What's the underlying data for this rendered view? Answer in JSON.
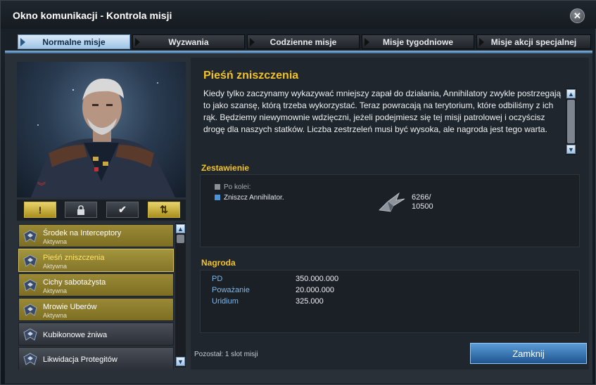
{
  "window": {
    "title": "Okno komunikacji - Kontrola misji",
    "close_icon": "close-icon"
  },
  "tabs": [
    {
      "label": "Normalne misje",
      "active": true
    },
    {
      "label": "Wyzwania",
      "active": false
    },
    {
      "label": "Codzienne misje",
      "active": false
    },
    {
      "label": "Misje tygodniowe",
      "active": false
    },
    {
      "label": "Misje akcji specjalnej",
      "active": false
    }
  ],
  "filters": [
    {
      "icon": "exclamation-icon",
      "glyph": "!"
    },
    {
      "icon": "lock-icon",
      "glyph": "🔒"
    },
    {
      "icon": "checkmark-icon",
      "glyph": "✔"
    },
    {
      "icon": "sort-arrows-icon",
      "glyph": "⇅"
    }
  ],
  "missions": [
    {
      "name": "Środek na Interceptory",
      "status": "Aktywna"
    },
    {
      "name": "Pieśń zniszczenia",
      "status": "Aktywna"
    },
    {
      "name": "Cichy sabotażysta",
      "status": "Aktywna"
    },
    {
      "name": "Mrowie Uberów",
      "status": "Aktywna"
    },
    {
      "name": "Kubikonowe żniwa",
      "status": ""
    },
    {
      "name": "Likwidacja Protegitów",
      "status": ""
    }
  ],
  "detail": {
    "title": "Pieśń zniszczenia",
    "description": "Kiedy tylko zaczynamy wykazywać mniejszy zapał do działania, Annihilatory zwykle postrzegają to jako szansę, którą trzeba wykorzystać. Teraz powracają na terytorium, które odbiliśmy z ich rąk. Będziemy niewymownie wdzięczni, jeżeli podejmiesz się tej misji patrolowej i oczyścisz drogę dla naszych statków. Liczba zestrzeleń musi być wysoka, ale nagroda jest tego warta.",
    "objectives_heading": "Zestawienie",
    "objective_group": "Po kolei:",
    "objective_item": "Zniszcz Annihilator.",
    "progress_current": "6266/",
    "progress_total": "10500",
    "reward_heading": "Nagroda",
    "rewards": [
      {
        "label": "PD",
        "value": "350.000.000"
      },
      {
        "label": "Poważanie",
        "value": "20.000.000"
      },
      {
        "label": "Uridium",
        "value": "325.000"
      }
    ]
  },
  "footer": {
    "slots_text": "Pozostał: 1 slot misji",
    "close_button": "Zamknij"
  },
  "colors": {
    "accent_gold": "#f3c32a",
    "accent_blue": "#7fb7e8",
    "active_tab": "#9ec4e6"
  }
}
